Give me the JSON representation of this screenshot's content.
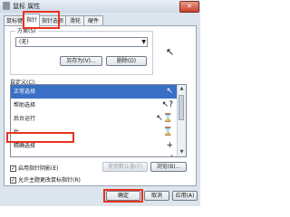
{
  "window": {
    "title": "鼠标 属性",
    "close_glyph": "✕"
  },
  "tabs": [
    {
      "label": "鼠标键",
      "active": false
    },
    {
      "label": "指针",
      "active": true
    },
    {
      "label": "指针选项",
      "active": false
    },
    {
      "label": "滑轮",
      "active": false
    },
    {
      "label": "硬件",
      "active": false
    }
  ],
  "scheme": {
    "label": "方案(S)",
    "value": "(无)",
    "save_as_label": "另存为(V)...",
    "delete_label": "删除(D)"
  },
  "preview": {
    "icon": "arrow-cursor-icon",
    "glyph": "↖"
  },
  "customize": {
    "label": "自定义(C):",
    "rows": [
      {
        "label": "正常选择",
        "icon": "arrow-cursor-icon",
        "glyph": "↖",
        "selected": true
      },
      {
        "label": "帮助选择",
        "icon": "help-cursor-icon",
        "glyph": "↖?",
        "selected": false
      },
      {
        "label": "后台运行",
        "icon": "busy-cursor-icon",
        "glyph": "↖⌛",
        "selected": false
      },
      {
        "label": "忙",
        "icon": "hourglass-icon",
        "glyph": "⌛",
        "selected": false
      },
      {
        "label": "精确选择",
        "icon": "crosshair-icon",
        "glyph": "+",
        "selected": false
      },
      {
        "label": "",
        "icon": "text-cursor-icon",
        "glyph": "I",
        "selected": false
      }
    ]
  },
  "options": {
    "shadow_label": "启用指针阴影(E)",
    "shadow_checked": true,
    "use_default_label": "使用默认值(F)",
    "browse_label": "浏览(B)...",
    "themes_label": "允许主题更改鼠标指针(R)",
    "themes_checked": true
  },
  "buttons": {
    "ok": "确定",
    "cancel": "取消",
    "apply": "应用(A)"
  },
  "colors": {
    "selection": "#3a6fc6",
    "highlight": "#e8321f"
  }
}
